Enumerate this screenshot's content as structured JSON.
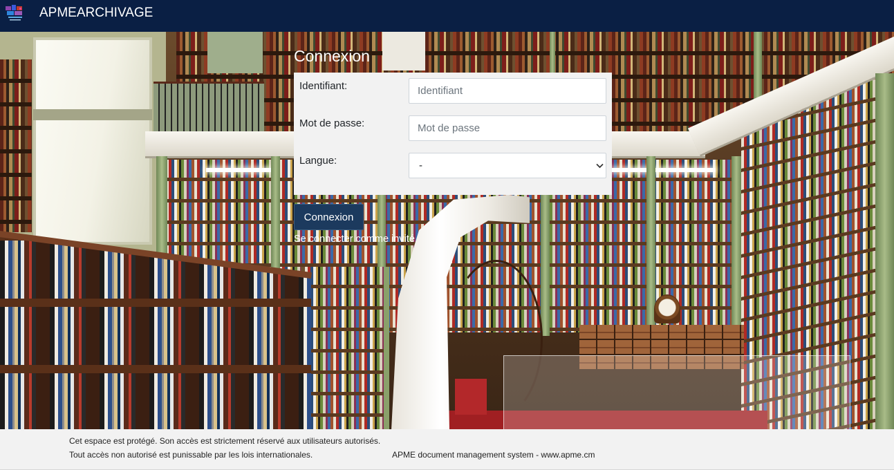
{
  "navbar": {
    "title": "APMEARCHIVAGE",
    "logo_icon": "logo-icon"
  },
  "login": {
    "heading": "Connexion",
    "username": {
      "label": "Identifiant:",
      "placeholder": "Identifiant",
      "value": ""
    },
    "password": {
      "label": "Mot de passe:",
      "placeholder": "Mot de passe",
      "value": ""
    },
    "language": {
      "label": "Langue:",
      "selected": "-",
      "icon": "chevron-down-icon"
    },
    "submit_label": "Connexion",
    "guest_link": "Se connecter comme invité"
  },
  "footer": {
    "notice_line1": "Cet espace est protégé. Son accès est strictement réservé aux utilisateurs autorisés.",
    "notice_line2": "Tout accès non autorisé est punissable par les lois internationales.",
    "credit": "APME document management system - www.apme.cm"
  },
  "colors": {
    "navbar": "#0a1f44",
    "nav_text": "#ffffff",
    "button": "#1c3a5e",
    "panel": "#f2f2f2",
    "footer": "#f2f2f2"
  }
}
